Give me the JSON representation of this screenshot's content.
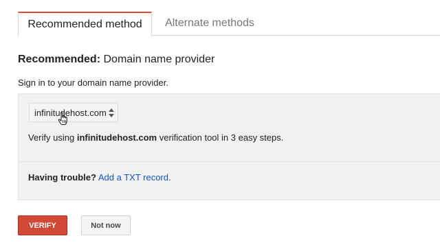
{
  "tabs": {
    "recommended_label": "Recommended method",
    "alternate_label": "Alternate methods"
  },
  "heading": {
    "prefix": "Recommended:",
    "title": "Domain name provider"
  },
  "intro": "Sign in to your domain name provider.",
  "provider_select": {
    "selected": "infinitudehost.com"
  },
  "verify_line": {
    "before": "Verify using ",
    "provider": "infinitudehost.com",
    "after": " verification tool in 3 easy steps."
  },
  "trouble": {
    "label": "Having trouble?",
    "link": "Add a TXT record."
  },
  "buttons": {
    "verify": "VERIFY",
    "not_now": "Not now"
  },
  "colors": {
    "active_tab_accent": "#dd4b39",
    "verify_button": "#d14836",
    "link": "#1155cc"
  }
}
